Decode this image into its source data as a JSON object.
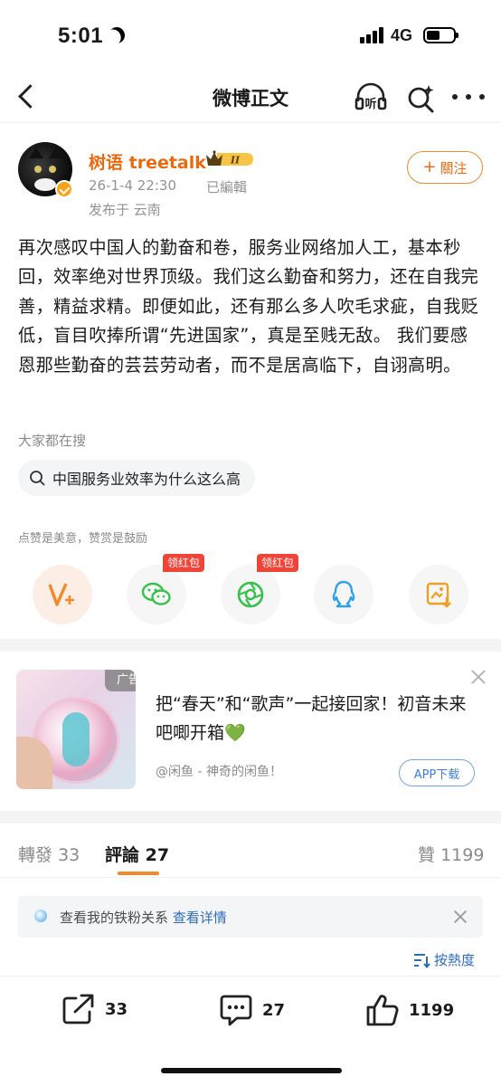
{
  "status_bar": {
    "time": "5:01",
    "network": "4G"
  },
  "navbar": {
    "title": "微博正文",
    "listen_label": "听"
  },
  "author": {
    "name": "树语 treetalk",
    "rank_badge": "II",
    "time": "26-1-4 22:30",
    "edited": "已編輯",
    "location": "发布于 云南",
    "follow_label": "關注",
    "follow_plus": "+"
  },
  "post": {
    "text": "再次感叹中国人的勤奋和卷，服务业网络加人工，基本秒回，效率绝对世界顶级。我们这么勤奋和努力，还在自我完善，精益求精。即便如此，还有那么多人吹毛求疵，自我贬低，盲目吹捧所谓“先进国家”，真是至贱无敌。 我们要感恩那些勤奋的芸芸劳动者，而不是居高临下，自诩高明。"
  },
  "hot_search": {
    "label": "大家都在搜",
    "query": "中国服务业效率为什么这么高"
  },
  "reward": {
    "label": "点赞是美意，赞赏是鼓励",
    "share_buttons": [
      {
        "icon": "v-plus-icon"
      },
      {
        "icon": "wechat-icon",
        "tag": "领红包"
      },
      {
        "icon": "moments-icon",
        "tag": "领红包"
      },
      {
        "icon": "qq-icon"
      },
      {
        "icon": "save-image-icon"
      }
    ]
  },
  "ad": {
    "tag": "广告",
    "title": "把“春天”和“歌声”一起接回家！初音未来吧唧开箱💚",
    "source": "@闲鱼 - 神奇的闲鱼！",
    "cta": "APP下载"
  },
  "tabs": {
    "repost_label": "轉發",
    "repost_count": "33",
    "comment_label": "評論",
    "comment_count": "27",
    "like_label": "贊",
    "like_count": "1199"
  },
  "fan_bar": {
    "text": "查看我的铁粉关系",
    "link": "查看详情"
  },
  "sort": {
    "label": "按熱度"
  },
  "bottom_bar": {
    "share_count": "33",
    "comment_count": "27",
    "like_count": "1199"
  },
  "colors": {
    "accent": "#e86b10",
    "link": "#2d6cb8",
    "tab_underline": "#f08a2c"
  }
}
